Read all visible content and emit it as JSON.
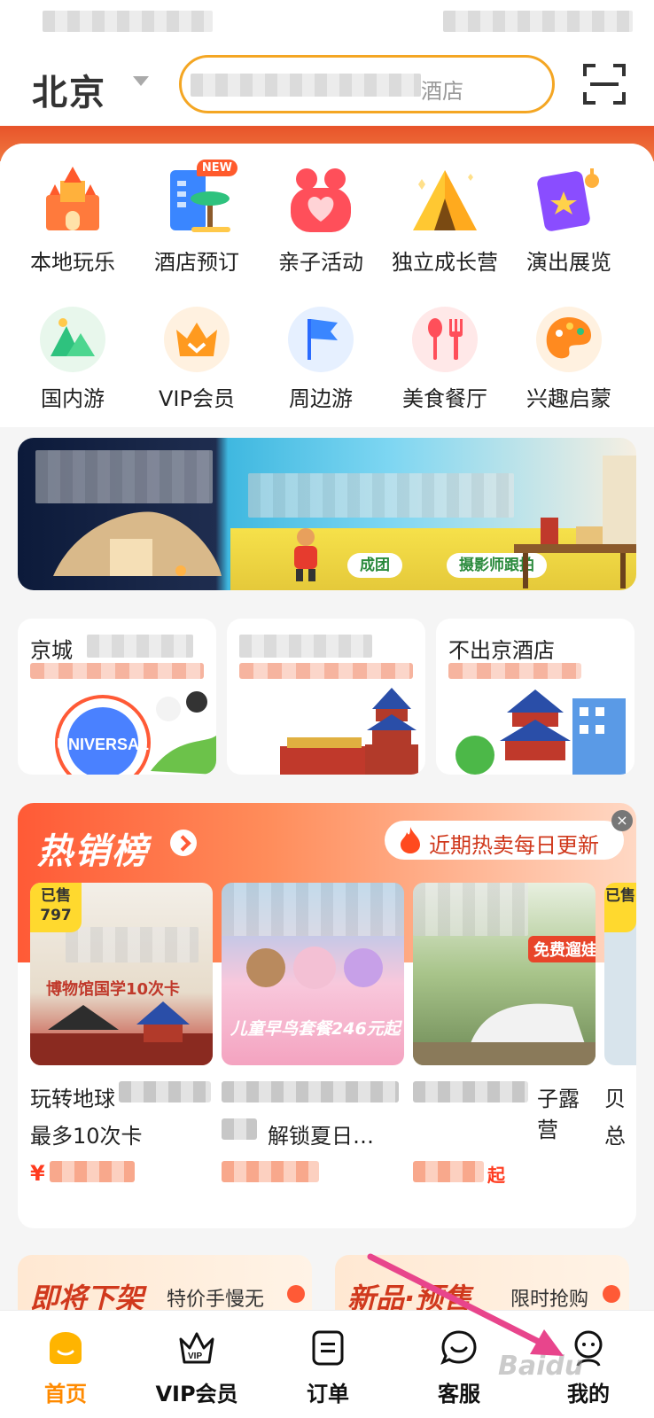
{
  "header": {
    "city": "北京",
    "search_text": "酒店"
  },
  "categories_row1": [
    {
      "label": "本地玩乐",
      "icon": "castle-icon"
    },
    {
      "label": "酒店预订",
      "icon": "hotel-icon",
      "badge": "NEW"
    },
    {
      "label": "亲子活动",
      "icon": "family-heart-icon"
    },
    {
      "label": "独立成长营",
      "icon": "tent-icon"
    },
    {
      "label": "演出展览",
      "icon": "ticket-icon"
    }
  ],
  "categories_row2": [
    {
      "label": "国内游",
      "icon": "mountain-icon"
    },
    {
      "label": "VIP会员",
      "icon": "crown-icon"
    },
    {
      "label": "周边游",
      "icon": "flag-icon"
    },
    {
      "label": "美食餐厅",
      "icon": "fork-spoon-icon"
    },
    {
      "label": "兴趣启蒙",
      "icon": "palette-icon"
    }
  ],
  "banner": {
    "tags": [
      "成团",
      "摄影师跟拍"
    ]
  },
  "sub_cards": [
    {
      "title": "京城"
    },
    {
      "title": ""
    },
    {
      "title": "不出京酒店"
    }
  ],
  "hot_list": {
    "title": "热销榜",
    "pill": "近期热卖每日更新",
    "close": "×",
    "products": [
      {
        "sold_label": "已售",
        "sold_count": "797",
        "img_caption": "博物馆国学10次卡",
        "name_visible": "玩转地球",
        "name_line2": "最多10次卡",
        "price_symbol": "¥"
      },
      {
        "sold_label": "",
        "sold_count": "",
        "img_caption": "儿童早鸟套餐246元起",
        "name_visible": "",
        "name_line2": "解锁夏日…",
        "price_symbol": ""
      },
      {
        "sold_label": "",
        "sold_count": "",
        "img_caption": "免费遛娃",
        "name_visible": "子露营",
        "name_line2": "",
        "price_symbol": "",
        "price_suffix": "起"
      }
    ],
    "partial_product": {
      "sold_label": "已售",
      "name_visible": "贝",
      "name_line2": "总",
      "price_symbol": "¥"
    }
  },
  "promos": [
    {
      "title": "即将下架",
      "sub": "特价手慢无"
    },
    {
      "title": "新品·预售",
      "sub": "限时抢购"
    }
  ],
  "tabbar": [
    {
      "label": "首页",
      "icon": "home-icon",
      "active": true
    },
    {
      "label": "VIP会员",
      "icon": "vip-crown-icon",
      "active": false
    },
    {
      "label": "订单",
      "icon": "order-icon",
      "active": false
    },
    {
      "label": "客服",
      "icon": "service-chat-icon",
      "active": false
    },
    {
      "label": "我的",
      "icon": "profile-icon",
      "active": false
    }
  ],
  "watermark": "Baidu",
  "colors": {
    "brand_orange": "#ff8a00",
    "hot_red": "#ff5a36",
    "search_border": "#f4a623",
    "price_red": "#ff3b1f",
    "annotation_arrow": "#e8458c"
  }
}
